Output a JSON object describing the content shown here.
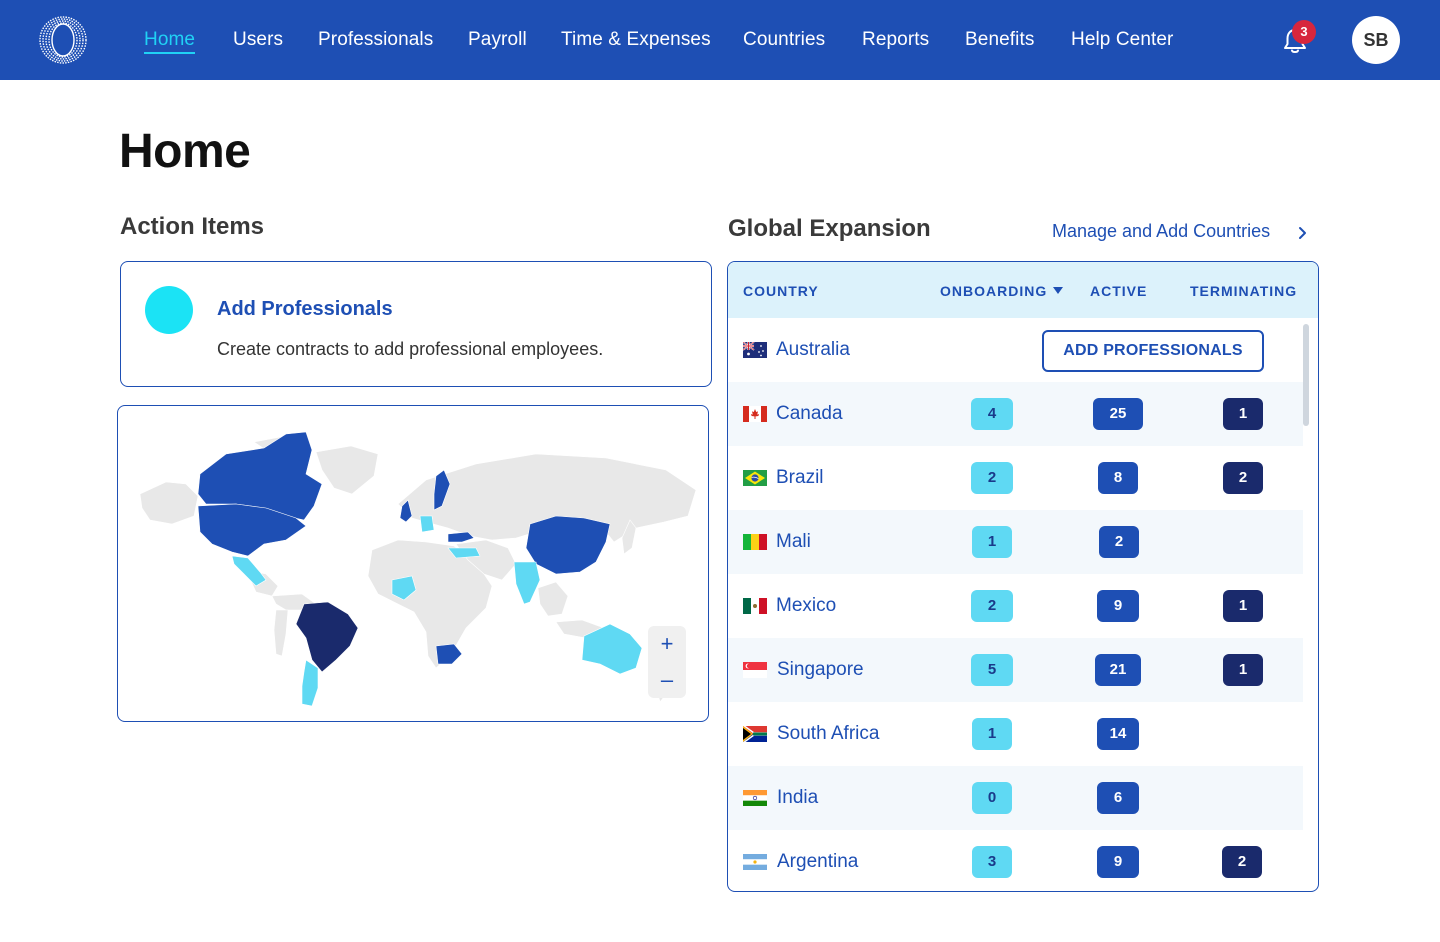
{
  "colors": {
    "brand_blue": "#1e4fb4",
    "accent_cyan": "#20d2f5",
    "navy": "#1a2a6c",
    "light_cyan": "#5fd9f3",
    "badge_red": "#d7263d"
  },
  "nav": {
    "logo_icon": "ring-logo-icon",
    "links": [
      "Home",
      "Users",
      "Professionals",
      "Payroll",
      "Time & Expenses",
      "Countries",
      "Reports",
      "Benefits",
      "Help Center"
    ],
    "active": "Home",
    "notifications_count": "3",
    "avatar_initials": "SB"
  },
  "page": {
    "title": "Home"
  },
  "action_items": {
    "title": "Action Items",
    "card_title": "Add Professionals",
    "card_desc": "Create contracts to add professional employees."
  },
  "map": {
    "zoom_in": "+",
    "zoom_out": "–",
    "active_countries": [
      "Canada",
      "United States",
      "China",
      "Sweden",
      "Turkey",
      "United Kingdom",
      "South Africa"
    ],
    "strong_countries": [
      "Brazil"
    ],
    "light_countries": [
      "Mexico",
      "India",
      "Australia",
      "Argentina",
      "Mali",
      "Germany",
      "Turkmenistan"
    ]
  },
  "global_expansion": {
    "title": "Global Expansion",
    "manage_link": "Manage and Add Countries",
    "columns": {
      "country": "COUNTRY",
      "onboarding": "ONBOARDING",
      "active": "ACTIVE",
      "terminating": "TERMINATING"
    },
    "add_button": "ADD PROFESSIONALS",
    "rows": [
      {
        "country": "Australia",
        "flag": "australia-flag-icon",
        "onboarding": null,
        "active": null,
        "terminating": null
      },
      {
        "country": "Canada",
        "flag": "canada-flag-icon",
        "onboarding": "4",
        "active": "25",
        "terminating": "1"
      },
      {
        "country": "Brazil",
        "flag": "brazil-flag-icon",
        "onboarding": "2",
        "active": "8",
        "terminating": "2"
      },
      {
        "country": "Mali",
        "flag": "mali-flag-icon",
        "onboarding": "1",
        "active": "2",
        "terminating": null
      },
      {
        "country": "Mexico",
        "flag": "mexico-flag-icon",
        "onboarding": "2",
        "active": "9",
        "terminating": "1"
      },
      {
        "country": "Singapore",
        "flag": "singapore-flag-icon",
        "onboarding": "5",
        "active": "21",
        "terminating": "1"
      },
      {
        "country": "South Africa",
        "flag": "south-africa-flag-icon",
        "onboarding": "1",
        "active": "14",
        "terminating": null
      },
      {
        "country": "India",
        "flag": "india-flag-icon",
        "onboarding": "0",
        "active": "6",
        "terminating": null
      },
      {
        "country": "Argentina",
        "flag": "argentina-flag-icon",
        "onboarding": "3",
        "active": "9",
        "terminating": "2"
      }
    ]
  }
}
